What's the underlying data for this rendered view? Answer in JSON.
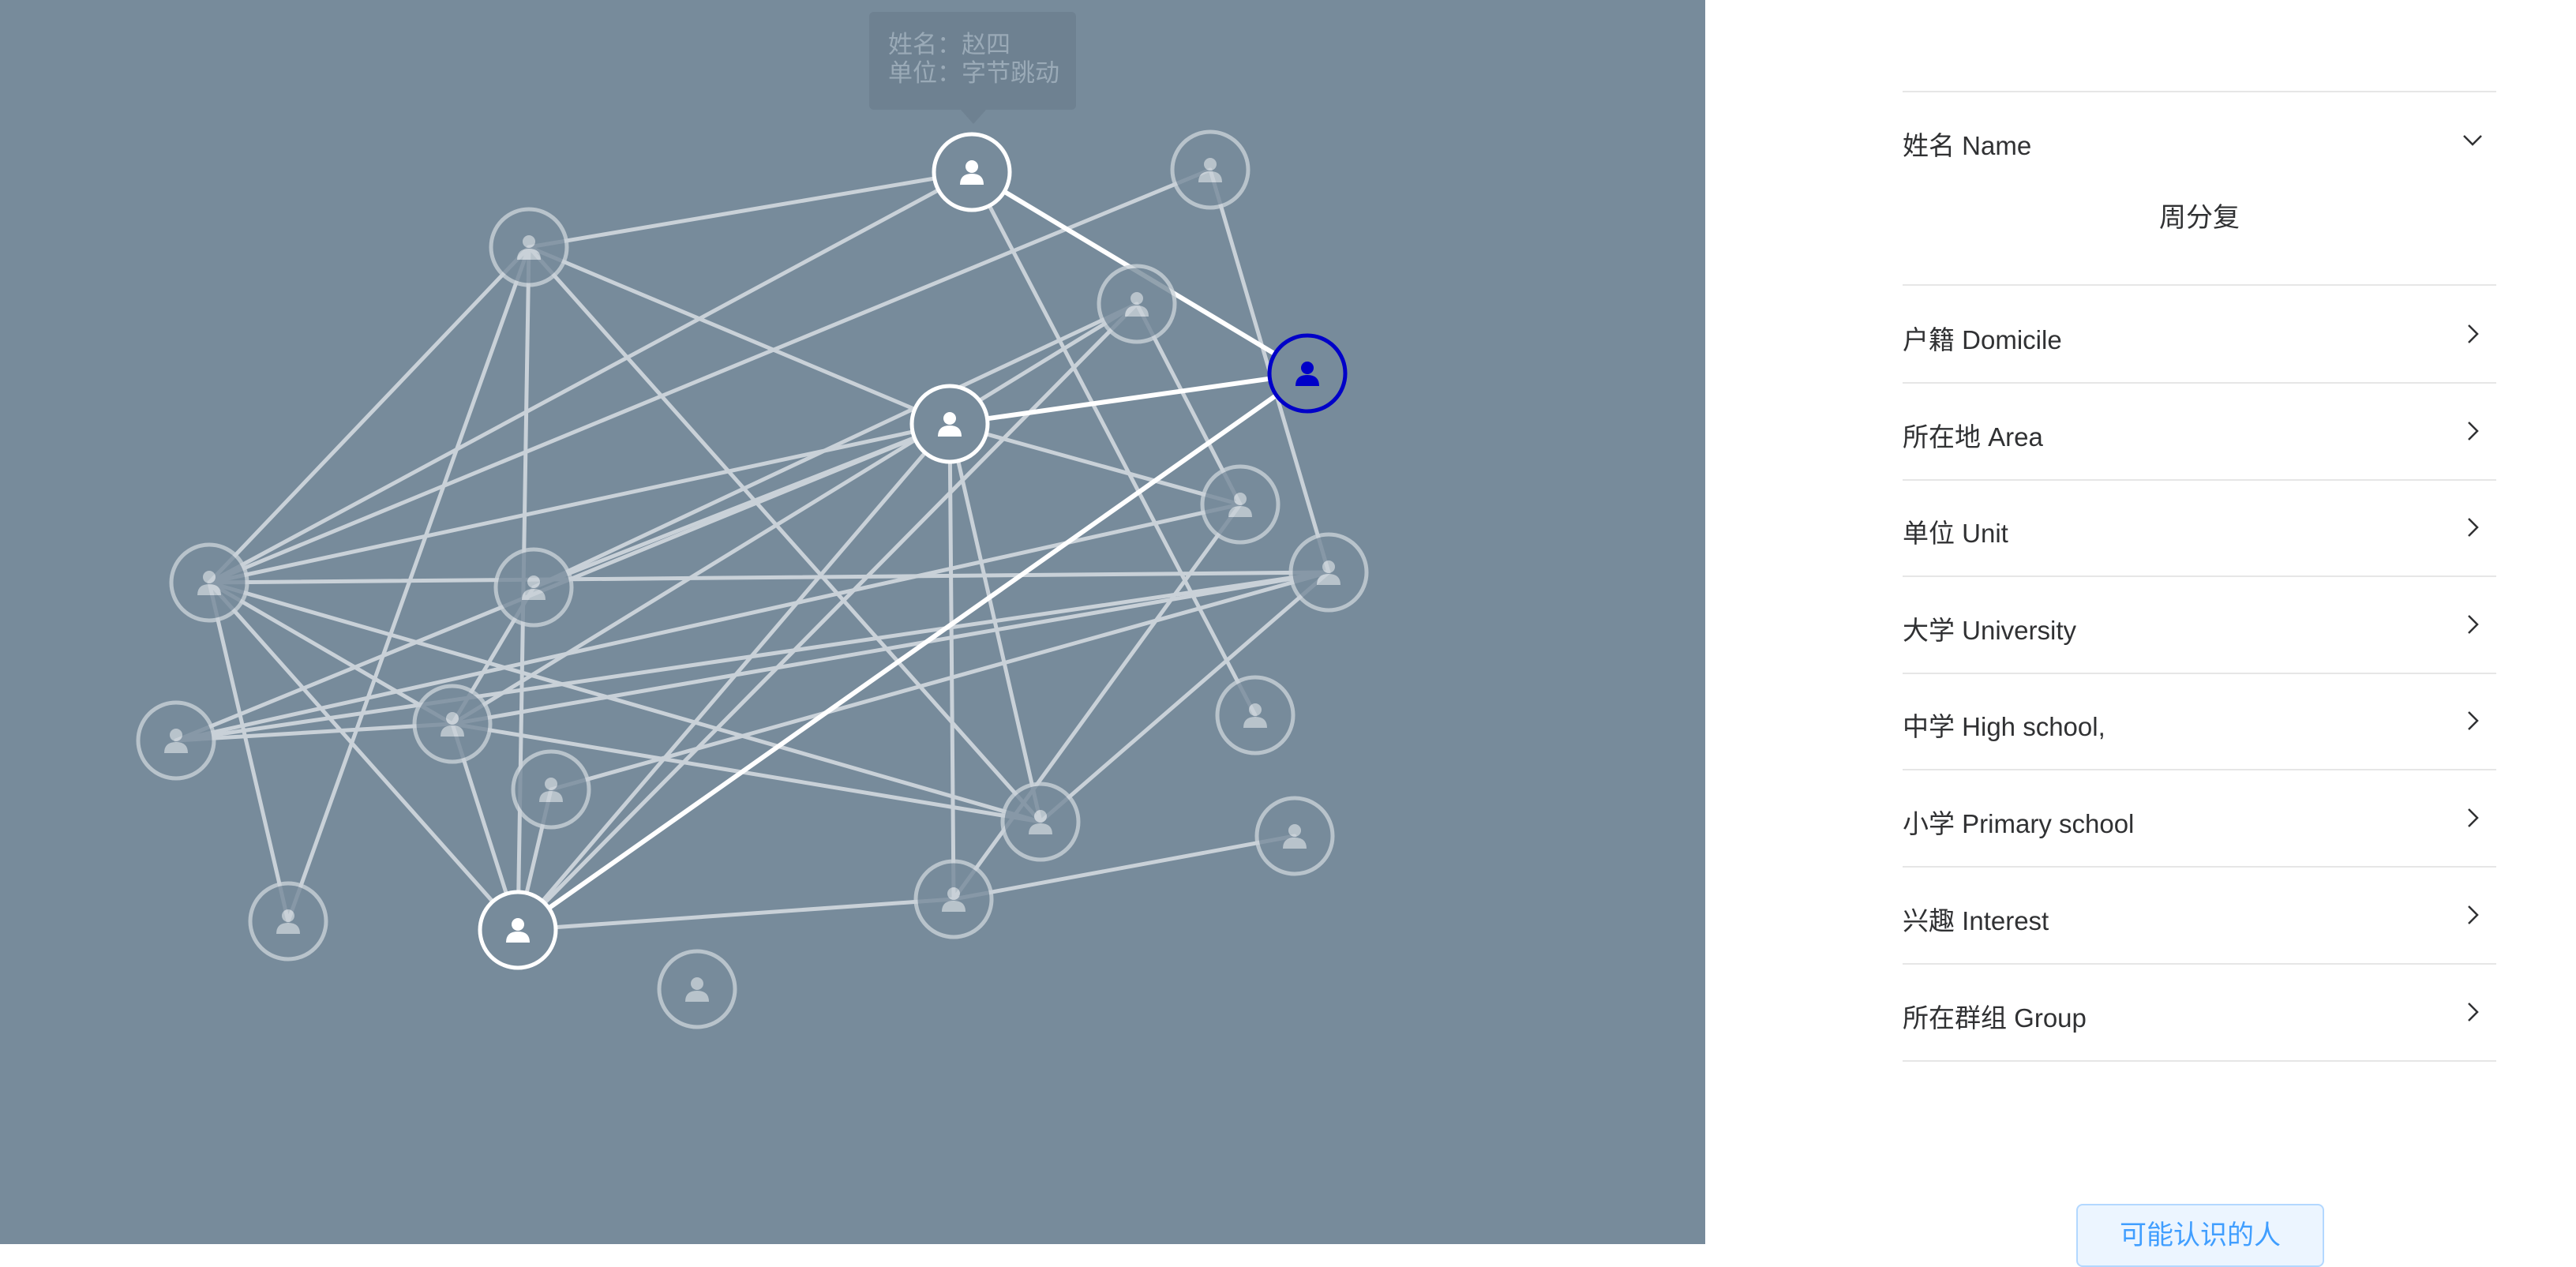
{
  "tooltip": {
    "name_line": "姓名：赵四",
    "unit_line": "单位：字节跳动"
  },
  "graph": {
    "node_icon": "person-icon",
    "colors": {
      "background": "#778b9b",
      "faded": "#c9d1d8",
      "highlight": "#ffffff",
      "selected": "#0000c8"
    }
  },
  "sidebar": {
    "sections": [
      {
        "label": "姓名 Name",
        "expanded": true,
        "value": "周分复"
      },
      {
        "label": "户籍 Domicile",
        "expanded": false
      },
      {
        "label": "所在地 Area",
        "expanded": false
      },
      {
        "label": "单位 Unit",
        "expanded": false
      },
      {
        "label": "大学 University",
        "expanded": false
      },
      {
        "label": "中学 High school,",
        "expanded": false
      },
      {
        "label": "小学 Primary school",
        "expanded": false
      },
      {
        "label": "兴趣 Interest",
        "expanded": false
      },
      {
        "label": "所在群组 Group",
        "expanded": false
      }
    ],
    "friends_button_label": "可能认识的人"
  }
}
